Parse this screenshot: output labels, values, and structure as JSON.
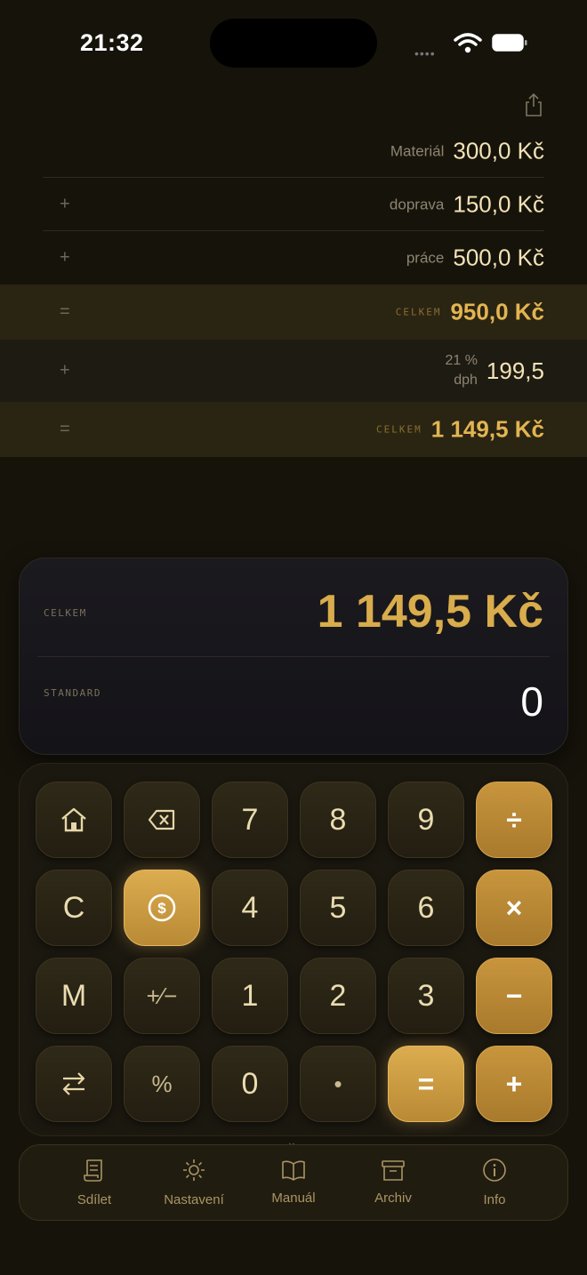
{
  "status_bar": {
    "time": "21:32"
  },
  "tape": [
    {
      "op": "",
      "label": "Materiál",
      "amount": "300,0 Kč"
    },
    {
      "op": "+",
      "label": "doprava",
      "amount": "150,0 Kč"
    },
    {
      "op": "+",
      "label": "práce",
      "amount": "500,0 Kč"
    },
    {
      "op": "=",
      "label": "CELKEM",
      "amount": "950,0 Kč"
    },
    {
      "op": "+",
      "label_line1": "21 %",
      "label_line2": "dph",
      "amount": "199,5"
    },
    {
      "op": "=",
      "label": "CELKEM",
      "amount": "1 149,5 Kč"
    }
  ],
  "display": {
    "total_label": "CELKEM",
    "total_value": "1 149,5 Kč",
    "mode_label": "STANDARD",
    "entry_value": "0"
  },
  "keys": {
    "home": "home-icon",
    "backspace": "backspace-icon",
    "seven": "7",
    "eight": "8",
    "nine": "9",
    "divide": "÷",
    "clear": "C",
    "currency": "dollar-icon",
    "four": "4",
    "five": "5",
    "six": "6",
    "multiply": "×",
    "memory": "M",
    "plus_minus": "+∕−",
    "one": "1",
    "two": "2",
    "three": "3",
    "minus": "−",
    "swap": "swap-icon",
    "percent": "%",
    "zero": "0",
    "decimal": "•",
    "equals": "=",
    "plus": "+"
  },
  "tabs": [
    "Sdílet",
    "Nastavení",
    "Manuál",
    "Archiv",
    "Info"
  ],
  "colors": {
    "gold": "#d9ac4c",
    "background": "#16130b",
    "operator_key": "#b8872f"
  }
}
